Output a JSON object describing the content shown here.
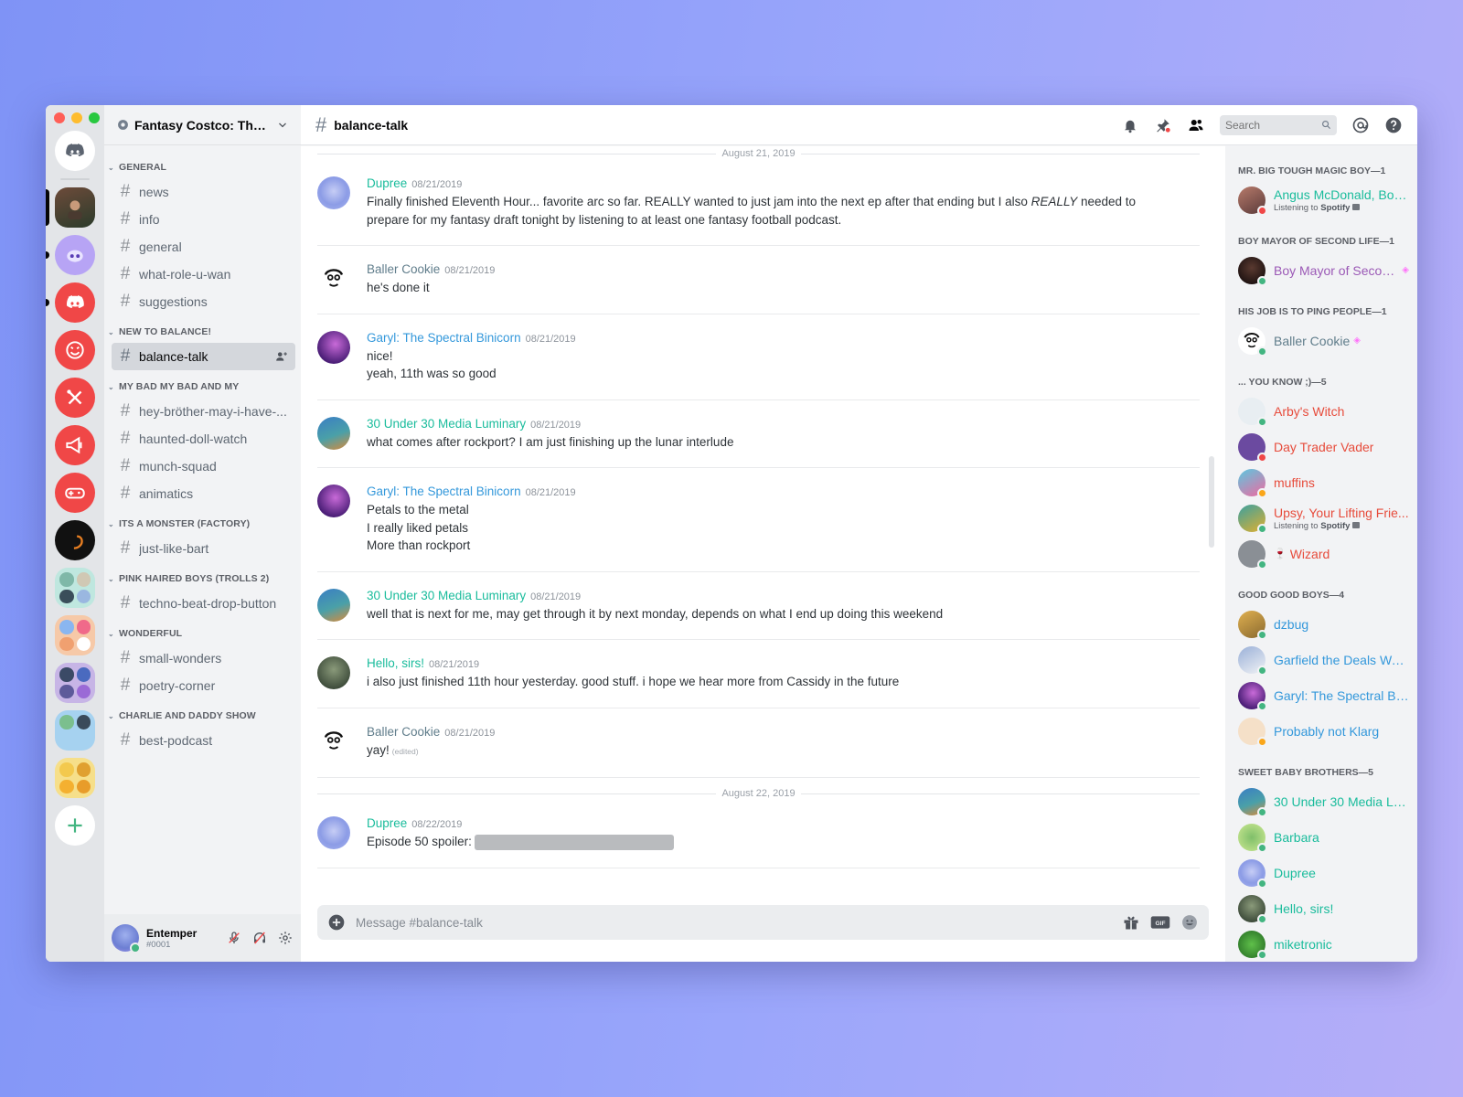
{
  "colors": {
    "teal": "#1abc9c",
    "blue": "#3498db",
    "gray_role": "#607d8b",
    "red": "#e74c3c",
    "purple": "#9b59b6",
    "online": "#43b581",
    "dnd": "#f04747",
    "idle": "#faa61a"
  },
  "server": {
    "name": "Fantasy Costco: The O..."
  },
  "categories": [
    {
      "name": "GENERAL",
      "channels": [
        "news",
        "info",
        "general",
        "what-role-u-wan",
        "suggestions"
      ]
    },
    {
      "name": "NEW TO BALANCE!",
      "channels": [
        "balance-talk"
      ]
    },
    {
      "name": "MY BAD MY BAD AND MY",
      "channels": [
        "hey-bröther-may-i-have-...",
        "haunted-doll-watch",
        "munch-squad",
        "animatics"
      ]
    },
    {
      "name": "ITS A MONSTER (FACTORY)",
      "channels": [
        "just-like-bart"
      ]
    },
    {
      "name": "PINK HAIRED BOYS (TROLLS 2)",
      "channels": [
        "techno-beat-drop-button"
      ]
    },
    {
      "name": "WONDERFUL",
      "channels": [
        "small-wonders",
        "poetry-corner"
      ]
    },
    {
      "name": "CHARLIE AND DADDY SHOW",
      "channels": [
        "best-podcast"
      ]
    }
  ],
  "selected_channel": "balance-talk",
  "user": {
    "name": "Entemper",
    "discriminator": "#0001"
  },
  "header": {
    "channel": "balance-talk",
    "search_placeholder": "Search"
  },
  "dates": {
    "d1": "August 21, 2019",
    "d2": "August 22, 2019"
  },
  "messages": [
    {
      "author": "Dupree",
      "color": "#1abc9c",
      "time": "08/21/2019",
      "lines": [
        "Finally finished Eleventh Hour... favorite arc so far. REALLY wanted to just jam into the next ep after that ending but I also ",
        "REALLY",
        " needed to",
        "prepare for my fantasy draft tonight by listening to at least one fantasy football podcast."
      ]
    },
    {
      "author": "Baller Cookie",
      "color": "#607d8b",
      "time": "08/21/2019",
      "lines": [
        "he's done it"
      ]
    },
    {
      "author": "Garyl: The Spectral Binicorn",
      "color": "#3498db",
      "time": "08/21/2019",
      "lines": [
        "nice!",
        "yeah, 11th was so good"
      ]
    },
    {
      "author": "30 Under 30 Media Luminary",
      "color": "#1abc9c",
      "time": "08/21/2019",
      "lines": [
        "what comes after rockport?  I am just finishing up the lunar interlude"
      ]
    },
    {
      "author": "Garyl: The Spectral Binicorn",
      "color": "#3498db",
      "time": "08/21/2019",
      "lines": [
        "Petals to the metal",
        "I really liked petals",
        "More than rockport"
      ]
    },
    {
      "author": "30 Under 30 Media Luminary",
      "color": "#1abc9c",
      "time": "08/21/2019",
      "lines": [
        "well that is next for me, may get through it by next monday, depends on what I end up doing this weekend"
      ]
    },
    {
      "author": "Hello, sirs!",
      "color": "#1abc9c",
      "time": "08/21/2019",
      "lines": [
        "i also just finished 11th hour yesterday. good stuff. i hope we hear more from Cassidy in the future"
      ]
    },
    {
      "author": "Baller Cookie",
      "color": "#607d8b",
      "time": "08/21/2019",
      "lines": [
        "yay!"
      ],
      "edited": "(edited)"
    },
    {
      "author": "Dupree",
      "color": "#1abc9c",
      "time": "08/22/2019",
      "lines": [
        "Episode 50 spoiler:"
      ]
    }
  ],
  "composer": {
    "placeholder": "Message #balance-talk"
  },
  "member_groups": [
    {
      "title": "MR. BIG TOUGH MAGIC BOY—1",
      "members": [
        {
          "name": "Angus McDonald, Boy...",
          "color": "#1abc9c",
          "status": "dnd",
          "activity_prefix": "Listening to ",
          "activity": "Spotify"
        }
      ]
    },
    {
      "title": "BOY MAYOR OF SECOND LIFE—1",
      "members": [
        {
          "name": "Boy Mayor of Secon...",
          "color": "#9b59b6",
          "status": "online",
          "gem": true
        }
      ]
    },
    {
      "title": "HIS JOB IS TO PING PEOPLE—1",
      "members": [
        {
          "name": "Baller Cookie",
          "color": "#607d8b",
          "status": "online",
          "gem": true
        }
      ]
    },
    {
      "title": "... YOU KNOW ;)—5",
      "members": [
        {
          "name": "Arby's Witch",
          "color": "#e74c3c",
          "status": "online"
        },
        {
          "name": "Day Trader Vader",
          "color": "#e74c3c",
          "status": "dnd"
        },
        {
          "name": "muffins",
          "color": "#e74c3c",
          "status": "idle"
        },
        {
          "name": "Upsy, Your Lifting Frie...",
          "color": "#e74c3c",
          "status": "online",
          "activity_prefix": "Listening to ",
          "activity": "Spotify"
        },
        {
          "name": "Wizard",
          "color": "#e74c3c",
          "status": "online",
          "emoji": true
        }
      ]
    },
    {
      "title": "GOOD GOOD BOYS—4",
      "members": [
        {
          "name": "dzbug",
          "color": "#3498db",
          "status": "online"
        },
        {
          "name": "Garfield the Deals Wa...",
          "color": "#3498db",
          "status": "online"
        },
        {
          "name": "Garyl: The Spectral Bi...",
          "color": "#3498db",
          "status": "online"
        },
        {
          "name": "Probably not Klarg",
          "color": "#3498db",
          "status": "idle"
        }
      ]
    },
    {
      "title": "SWEET BABY BROTHERS—5",
      "members": [
        {
          "name": "30 Under 30 Media Lu...",
          "color": "#1abc9c",
          "status": "online"
        },
        {
          "name": "Barbara",
          "color": "#1abc9c",
          "status": "online"
        },
        {
          "name": "Dupree",
          "color": "#1abc9c",
          "status": "online"
        },
        {
          "name": "Hello, sirs!",
          "color": "#1abc9c",
          "status": "online"
        },
        {
          "name": "miketronic",
          "color": "#1abc9c",
          "status": "online"
        }
      ]
    }
  ]
}
